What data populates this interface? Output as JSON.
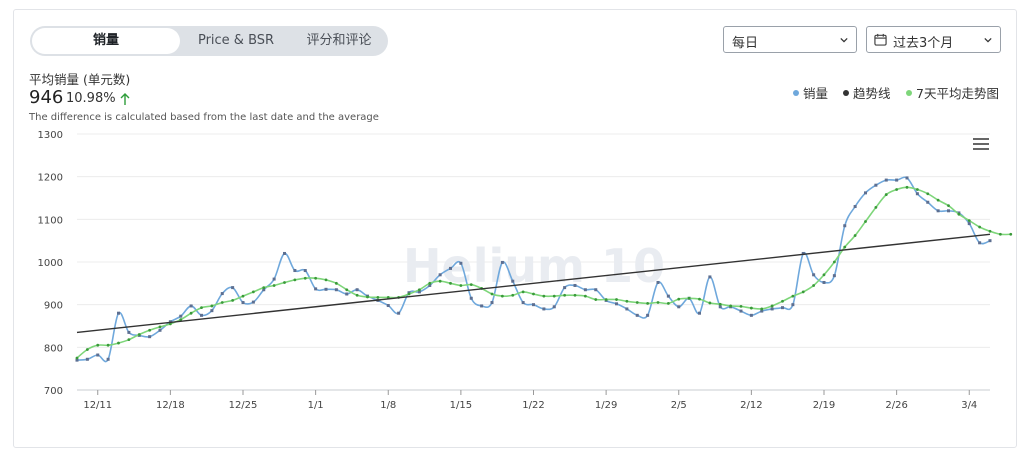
{
  "tabs": [
    {
      "label": "销量",
      "active": true
    },
    {
      "label": "Price & BSR",
      "active": false
    },
    {
      "label": "评分和评论",
      "active": false
    }
  ],
  "controls": {
    "interval": "每日",
    "range": "过去3个月"
  },
  "summary": {
    "label": "平均销量 (单元数)",
    "value": "946",
    "change": "10.98%",
    "change_direction": "up",
    "note": "The difference is calculated based from the last date and the average"
  },
  "watermark": "Helium 10",
  "colors": {
    "sales": "#6fa8dc",
    "trend": "#333333",
    "avg7": "#7ed67a",
    "up_arrow": "#2e9d3a"
  },
  "chart_data": {
    "type": "line",
    "x_tick_labels": [
      "12/11",
      "12/18",
      "12/25",
      "1/1",
      "1/8",
      "1/15",
      "1/22",
      "1/29",
      "2/5",
      "2/12",
      "2/19",
      "2/26",
      "3/4"
    ],
    "x_start": "12/9",
    "ylim": [
      700,
      1300
    ],
    "y_ticks": [
      700,
      800,
      900,
      1000,
      1100,
      1200,
      1300
    ],
    "grid": true,
    "legend_position": "top-right",
    "series": [
      {
        "name": "销量",
        "color": "#6fa8dc",
        "marker": "square",
        "values": [
          770,
          772,
          782,
          772,
          880,
          835,
          828,
          825,
          840,
          860,
          873,
          897,
          875,
          886,
          926,
          940,
          905,
          906,
          935,
          960,
          1020,
          980,
          980,
          937,
          936,
          935,
          925,
          935,
          920,
          910,
          898,
          880,
          928,
          930,
          945,
          970,
          985,
          997,
          915,
          897,
          905,
          999,
          955,
          905,
          900,
          890,
          895,
          940,
          945,
          935,
          935,
          910,
          902,
          890,
          875,
          875,
          952,
          920,
          895,
          915,
          880,
          965,
          895,
          895,
          885,
          875,
          885,
          890,
          893,
          900,
          1020,
          970,
          952,
          968,
          1085,
          1130,
          1162,
          1180,
          1192,
          1192,
          1197,
          1160,
          1140,
          1120,
          1120,
          1115,
          1090,
          1045,
          1050
        ]
      },
      {
        "name": "7天平均走势图",
        "color": "#7ed67a",
        "marker": "dot",
        "values": [
          775,
          795,
          805,
          805,
          810,
          818,
          830,
          840,
          848,
          855,
          865,
          880,
          893,
          897,
          905,
          910,
          920,
          930,
          940,
          945,
          952,
          958,
          962,
          962,
          958,
          950,
          935,
          922,
          918,
          917,
          917,
          917,
          925,
          935,
          950,
          955,
          950,
          945,
          947,
          938,
          925,
          920,
          922,
          930,
          925,
          920,
          920,
          922,
          922,
          920,
          912,
          912,
          912,
          908,
          905,
          903,
          905,
          903,
          913,
          915,
          913,
          904,
          901,
          897,
          896,
          892,
          890,
          897,
          908,
          920,
          930,
          945,
          970,
          1000,
          1035,
          1062,
          1095,
          1128,
          1158,
          1170,
          1175,
          1170,
          1160,
          1145,
          1132,
          1112,
          1097,
          1082,
          1072,
          1065,
          1065
        ]
      },
      {
        "name": "趋势线",
        "color": "#333333",
        "marker": "none",
        "values": [
          835,
          1065
        ]
      }
    ]
  }
}
